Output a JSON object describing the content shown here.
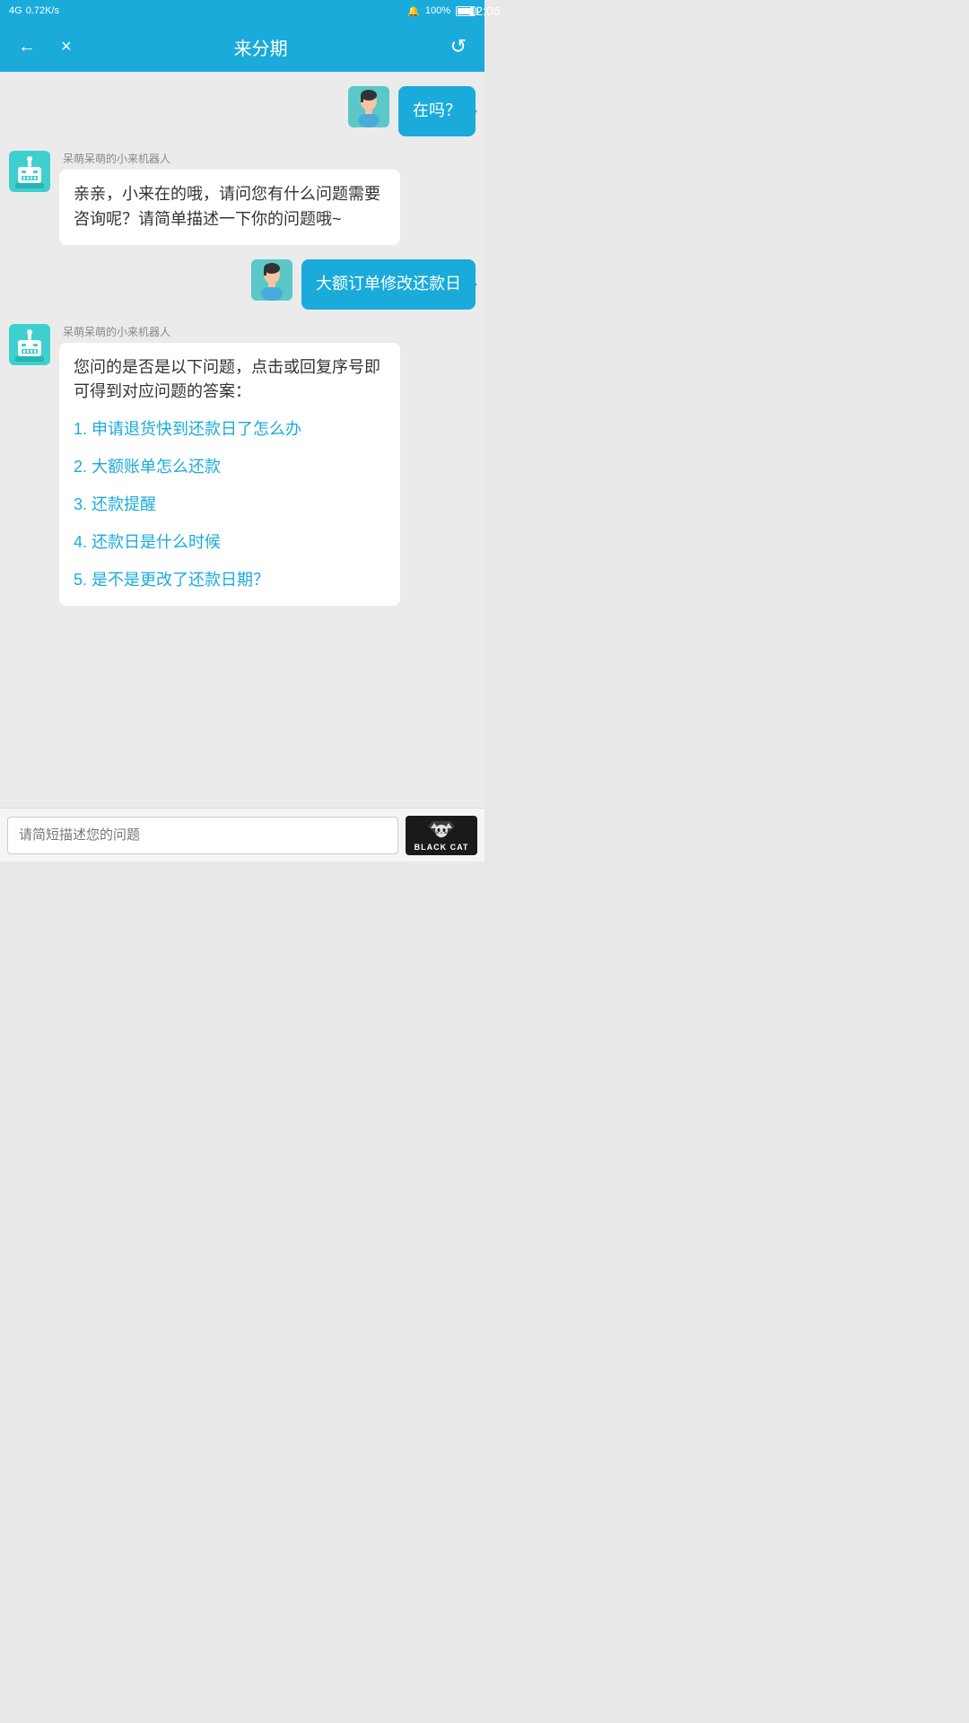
{
  "statusBar": {
    "signal": "4G4G",
    "speed": "0.72K/s",
    "time": "12:06",
    "battery": "100%"
  },
  "header": {
    "title": "来分期",
    "backLabel": "←",
    "closeLabel": "×",
    "refreshLabel": "↺"
  },
  "messages": [
    {
      "id": "msg1",
      "type": "user",
      "text": "在吗？"
    },
    {
      "id": "msg2",
      "type": "bot",
      "senderName": "呆萌呆萌的小来机器人",
      "text": "亲亲，小来在的哦，请问您有什么问题需要咨询呢？请简单描述一下你的问题哦~"
    },
    {
      "id": "msg3",
      "type": "user",
      "text": "大额订单修改还款日"
    },
    {
      "id": "msg4",
      "type": "bot",
      "senderName": "呆萌呆萌的小来机器人",
      "intro": "您问的是否是以下问题，点击或回复序号即可得到对应问题的答案：",
      "links": [
        "1. 申请退货快到还款日了怎么办",
        "2. 大额账单怎么还款",
        "3. 还款提醒",
        "4. 还款日是什么时候",
        "5. 是不是更改了还款日期？"
      ]
    }
  ],
  "inputBar": {
    "placeholder": "请简短描述您的问题",
    "blackCatText": "BLACK CAT"
  }
}
